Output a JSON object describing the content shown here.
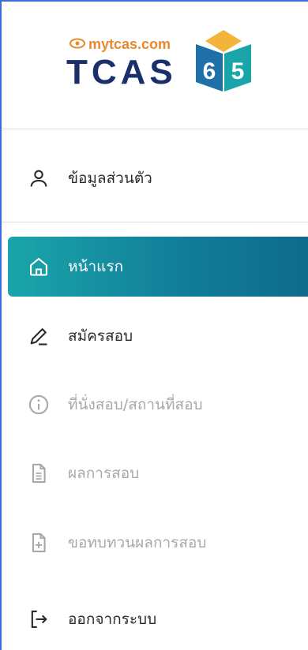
{
  "logo": {
    "site": "mytcas.com",
    "brand": "TCAS",
    "year_left": "6",
    "year_right": "5"
  },
  "menu": {
    "profile": "ข้อมูลส่วนตัว",
    "home": "หน้าแรก",
    "apply": "สมัครสอบ",
    "seat": "ที่นั่งสอบ/สถานที่สอบ",
    "results": "ผลการสอบ",
    "review": "ขอทบทวนผลการสอบ",
    "logout": "ออกจากระบบ"
  },
  "colors": {
    "accent": "#1aa5aa",
    "brand": "#1b2f6b",
    "orange": "#e7892d",
    "disabled": "#a8a8a8"
  }
}
